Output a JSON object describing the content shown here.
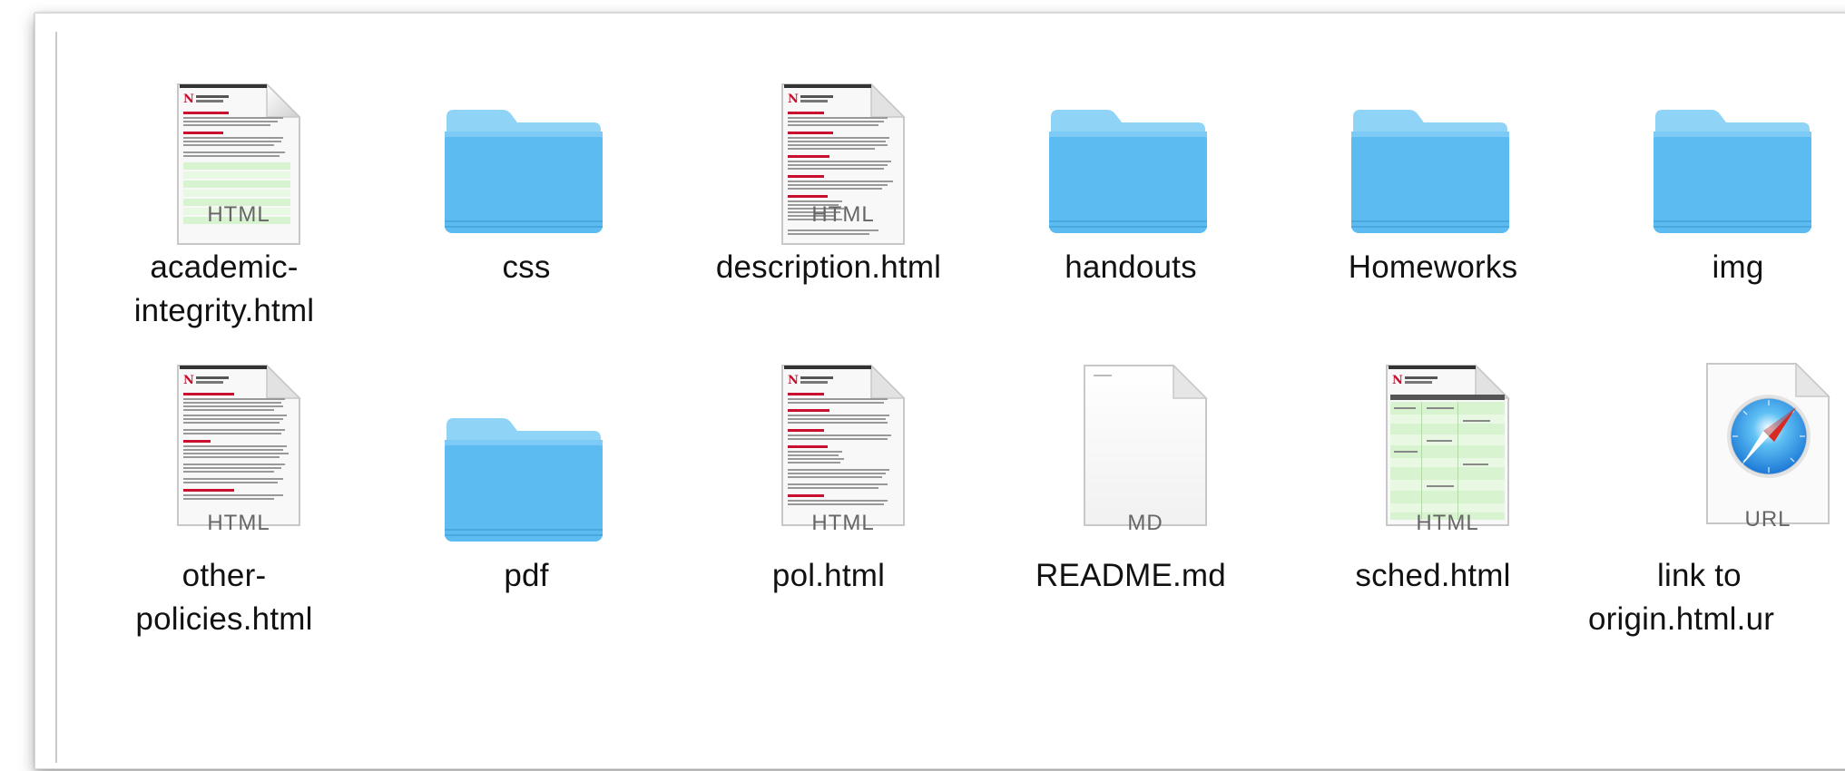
{
  "finder": {
    "items": [
      {
        "name": "academic-\nintegrity.html",
        "line1": "academic-",
        "line2": "integrity.html",
        "kind": "html-doc",
        "badge": "HTML",
        "icon": "html-document-icon"
      },
      {
        "name": "css",
        "line1": "css",
        "line2": "",
        "kind": "folder",
        "icon": "folder-icon"
      },
      {
        "name": "description.html",
        "line1": "description.html",
        "line2": "",
        "kind": "html-doc",
        "badge": "HTML",
        "icon": "html-document-icon"
      },
      {
        "name": "handouts",
        "line1": "handouts",
        "line2": "",
        "kind": "folder",
        "icon": "folder-icon"
      },
      {
        "name": "Homeworks",
        "line1": "Homeworks",
        "line2": "",
        "kind": "folder",
        "icon": "folder-icon"
      },
      {
        "name": "img",
        "line1": "img",
        "line2": "",
        "kind": "folder",
        "icon": "folder-icon"
      },
      {
        "name": "other-\npolicies.html",
        "line1": "other-",
        "line2": "policies.html",
        "kind": "html-doc",
        "badge": "HTML",
        "icon": "html-document-icon"
      },
      {
        "name": "pdf",
        "line1": "pdf",
        "line2": "",
        "kind": "folder",
        "icon": "folder-icon"
      },
      {
        "name": "pol.html",
        "line1": "pol.html",
        "line2": "",
        "kind": "html-doc",
        "badge": "HTML",
        "icon": "html-document-icon"
      },
      {
        "name": "README.md",
        "line1": "README.md",
        "line2": "",
        "kind": "md-doc",
        "badge": "MD",
        "icon": "markdown-document-icon"
      },
      {
        "name": "sched.html",
        "line1": "sched.html",
        "line2": "",
        "kind": "html-doc-green",
        "badge": "HTML",
        "icon": "html-document-icon"
      },
      {
        "name": "link to origin.html.url",
        "line1": "link to",
        "line2": "origin.html.ur",
        "kind": "url",
        "badge": "URL",
        "icon": "safari-compass-icon"
      }
    ]
  },
  "colors": {
    "folder_top": "#8fd3f7",
    "folder_body": "#5cbcf2",
    "folder_bottom": "#4aa8df",
    "accent_red": "#c8102e",
    "doc_bg": "#f7f7f7"
  }
}
